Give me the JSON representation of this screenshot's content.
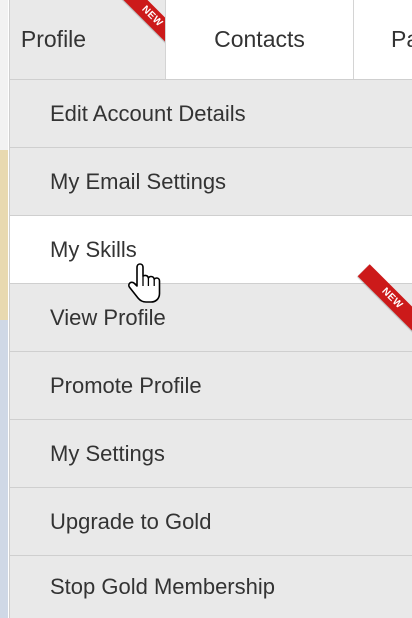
{
  "tabs": [
    {
      "label": "Profile",
      "badge": "NEW",
      "active": true
    },
    {
      "label": "Contacts"
    },
    {
      "label": "Pa"
    }
  ],
  "menu": {
    "items": [
      {
        "label": "Edit Account Details"
      },
      {
        "label": "My Email Settings"
      },
      {
        "label": "My Skills",
        "hovered": true
      },
      {
        "label": "View Profile",
        "badge": "NEW"
      },
      {
        "label": "Promote Profile"
      },
      {
        "label": "My Settings"
      },
      {
        "label": "Upgrade to Gold"
      },
      {
        "label": "Stop Gold Membership"
      }
    ]
  },
  "cursor": {
    "icon": "hand-pointer-icon"
  },
  "colors": {
    "badge": "#cc1a1a",
    "menu_bg": "#e9e9e9",
    "active_bg": "#ffffff"
  }
}
